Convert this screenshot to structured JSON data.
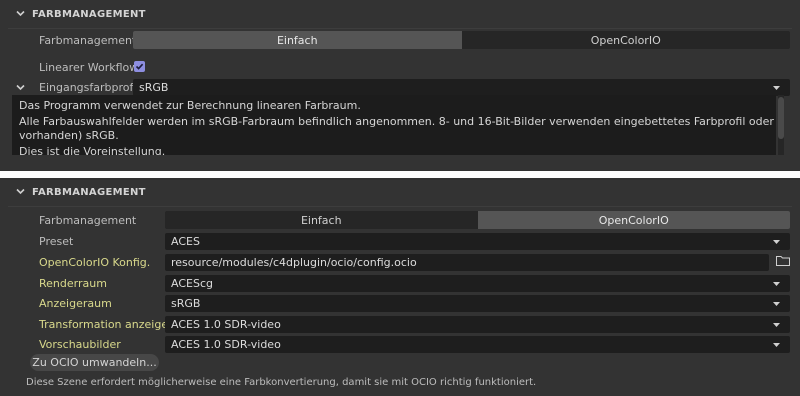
{
  "panel1": {
    "section_title": "FARBMANAGEMENT",
    "color_management_label": "Farbmanagement",
    "modes": [
      "Einfach",
      "OpenColorIO"
    ],
    "selected_mode": "Einfach",
    "linear_workflow_label": "Linearer Workflow",
    "linear_workflow_checked": true,
    "input_profile_label": "Eingangsfarbprofil",
    "input_profile_value": "sRGB",
    "description_lines": [
      "Das Programm verwendet zur Berechnung linearen Farbraum.",
      "Alle Farbauswahlfelder werden im sRGB-Farbraum befindlich angenommen. 8- und 16-Bit-Bilder verwenden eingebettetes Farbprofil oder (falls nicht",
      "vorhanden) sRGB.",
      "Dies ist die Voreinstellung."
    ]
  },
  "panel2": {
    "section_title": "FARBMANAGEMENT",
    "color_management_label": "Farbmanagement",
    "modes": [
      "Einfach",
      "OpenColorIO"
    ],
    "selected_mode": "OpenColorIO",
    "preset_label": "Preset",
    "preset_value": "ACES",
    "ocio_config_label": "OpenColorIO Konfig.",
    "ocio_config_value": "resource/modules/c4dplugin/ocio/config.ocio",
    "render_space_label": "Renderraum",
    "render_space_value": "ACEScg",
    "display_space_label": "Anzeigeraum",
    "display_space_value": "sRGB",
    "view_transform_label": "Transformation anzeigen",
    "view_transform_value": "ACES 1.0 SDR-video",
    "thumbnails_label": "Vorschaubilder",
    "thumbnails_value": "ACES 1.0 SDR-video",
    "convert_button_label": "Zu OCIO umwandeln...",
    "note": "Diese Szene erfordert möglicherweise eine Farbkonvertierung, damit sie mit OCIO richtig funktioniert."
  },
  "colors": {
    "panel_bg": "#333333",
    "field_bg": "#1e1e1e",
    "selected_segment": "#555555",
    "highlight_label": "#d9d98c",
    "checkbox": "#8d8ee0"
  }
}
